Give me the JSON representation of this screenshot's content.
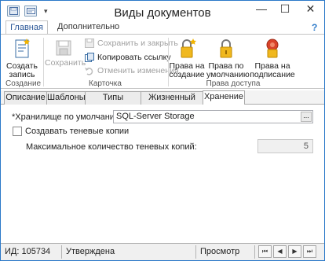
{
  "window": {
    "title": "Виды документов",
    "controls": {
      "minimize": "—",
      "maximize": "☐",
      "close": "✕"
    }
  },
  "ribbon_tabs": [
    "Главная",
    "Дополнительно"
  ],
  "help": "?",
  "ribbon": {
    "groups": {
      "create": "Создание",
      "card": "Карточка",
      "access": "Права доступа"
    },
    "create_record": [
      "Создать",
      "запись"
    ],
    "save": "Сохранить",
    "save_and_close": "Сохранить и закрыть",
    "copy_link": "Копировать ссылку",
    "cancel_changes": "Отменить изменения",
    "rights_create": [
      "Права на",
      "создание"
    ],
    "rights_default": [
      "Права по",
      "умолчанию"
    ],
    "rights_sign": [
      "Права на",
      "подписание"
    ]
  },
  "content_tabs": [
    "Описание",
    "Шаблоны",
    "Типы карточек",
    "Жизненный цикл",
    "Хранение"
  ],
  "form": {
    "storage_label": "*Хранилище по умолчанию:",
    "storage_value": "SQL-Server Storage",
    "storage_button": "...",
    "shadow_copies_label": "Создавать теневые копии",
    "shadow_copies_checked": false,
    "max_shadow_label": "Максимальное количество теневых копий:",
    "max_shadow_value": "5"
  },
  "status": {
    "id": "ИД: 105734",
    "state": "Утверждена",
    "mode": "Просмотр",
    "nav": [
      "⏮",
      "◀",
      "▶",
      "⏭"
    ]
  },
  "colors": {
    "accent": "#2b79c9",
    "tab_active": "#2b5797"
  }
}
